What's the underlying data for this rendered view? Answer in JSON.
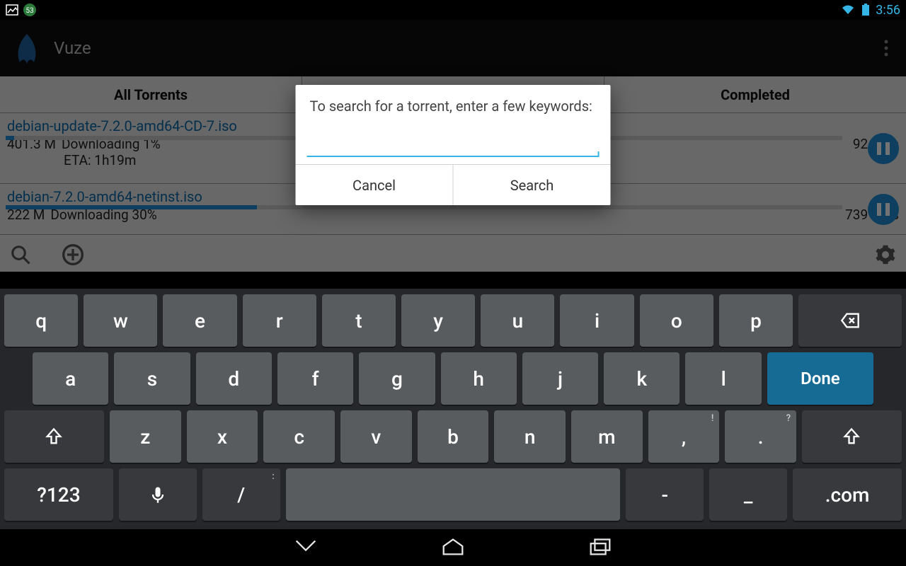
{
  "statusbar": {
    "time": "3:56"
  },
  "actionbar": {
    "title": "Vuze"
  },
  "tabs": {
    "all": "All Torrents",
    "downloading": "",
    "completed": "Completed"
  },
  "torrents": [
    {
      "name": "debian-update-7.2.0-amd64-CD-7.iso",
      "size": "401.3 M",
      "status": "Downloading 1%",
      "eta": "ETA: 1h19m",
      "speed": "92 kB/s",
      "progress_pct": 1
    },
    {
      "name": "debian-7.2.0-amd64-netinst.iso",
      "size": "222 M",
      "status": "Downloading 30%",
      "eta": "",
      "speed": "739 kB/s",
      "progress_pct": 30
    }
  ],
  "dialog": {
    "title": "To search for a torrent, enter a few keywords:",
    "input_value": "",
    "cancel": "Cancel",
    "search": "Search"
  },
  "keyboard": {
    "row1": [
      "q",
      "w",
      "e",
      "r",
      "t",
      "y",
      "u",
      "i",
      "o",
      "p"
    ],
    "row2": [
      "a",
      "s",
      "d",
      "f",
      "g",
      "h",
      "j",
      "k",
      "l"
    ],
    "row3": [
      "z",
      "x",
      "c",
      "v",
      "b",
      "n",
      "m",
      ",",
      "."
    ],
    "row3_hints": {
      ",": "!",
      ".": "?"
    },
    "symbols_label": "?123",
    "slash": "/",
    "dash": "-",
    "underscore": "_",
    "dotcom": ".com",
    "done": "Done"
  },
  "colors": {
    "accent": "#34b5e5",
    "vuze_blue": "#1f5f9e",
    "key_bg": "#595c5f",
    "key_dark": "#37393c"
  }
}
